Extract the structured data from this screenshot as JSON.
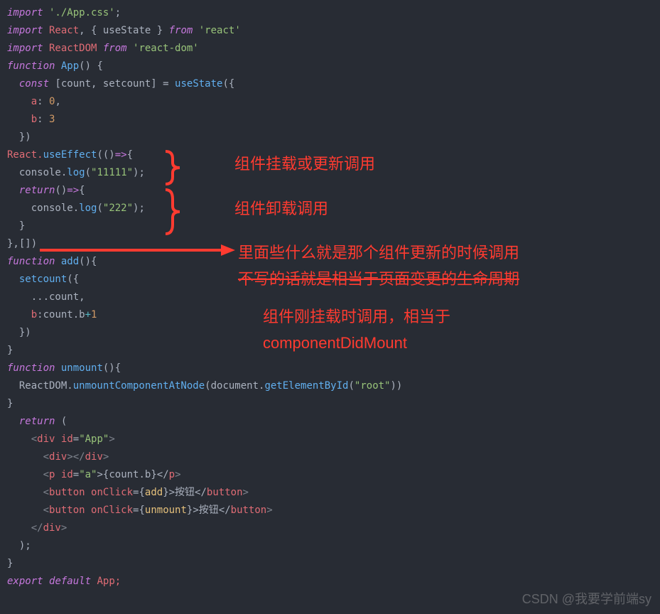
{
  "code": {
    "l1a": "import",
    "l1b": " './App.css'",
    "l1c": ";",
    "l2a": "import",
    "l2b": " React",
    "l2c": ", { useState } ",
    "l2d": "from",
    "l2e": " 'react'",
    "l3a": "import",
    "l3b": " ReactDOM ",
    "l3c": "from",
    "l3d": " 'react-dom'",
    "l4a": "function",
    "l4b": " App",
    "l4c": "() {",
    "l5a": "  ",
    "l5b": "const",
    "l5c": " [count, setcount] = ",
    "l5d": "useState",
    "l5e": "({",
    "l6a": "    ",
    "l6b": "a",
    "l6c": ": ",
    "l6d": "0",
    "l6e": ",",
    "l7a": "    ",
    "l7b": "b",
    "l7c": ": ",
    "l7d": "3",
    "l8": "  })",
    "l9a": "React.",
    "l9b": "useEffect",
    "l9c": "(()",
    "l9d": "=>",
    "l9e": "{",
    "l10a": "  console.",
    "l10b": "log",
    "l10c": "(",
    "l10d": "\"11111\"",
    "l10e": ");",
    "l11a": "  ",
    "l11b": "return",
    "l11c": "()",
    "l11d": "=>",
    "l11e": "{",
    "l12a": "    console.",
    "l12b": "log",
    "l12c": "(",
    "l12d": "\"222\"",
    "l12e": ");",
    "l13": "  }",
    "l14": "},[])",
    "l15a": "function",
    "l15b": " add",
    "l15c": "(){",
    "l16a": "  ",
    "l16b": "setcount",
    "l16c": "({",
    "l17": "    ...count,",
    "l18a": "    ",
    "l18b": "b",
    "l18c": ":count.b",
    "l18d": "+",
    "l18e": "1",
    "l19": "  })",
    "l20": "}",
    "l21a": "function",
    "l21b": " unmount",
    "l21c": "(){",
    "l22a": "  ReactDOM.",
    "l22b": "unmountComponentAtNode",
    "l22c": "(document.",
    "l22d": "getElementById",
    "l22e": "(",
    "l22f": "\"root\"",
    "l22g": "))",
    "l23": "}",
    "l24a": "  ",
    "l24b": "return",
    "l24c": " (",
    "l25a": "    <",
    "l25b": "div",
    "l25c": " ",
    "l25d": "id",
    "l25e": "=",
    "l25f": "\"App\"",
    "l25g": ">",
    "l26a": "      <",
    "l26b": "div",
    "l26c": "></",
    "l26d": "div",
    "l26e": ">",
    "l27a": "      <",
    "l27b": "p",
    "l27c": " ",
    "l27d": "id",
    "l27e": "=",
    "l27f": "\"a\"",
    "l27g": ">{count.b}</",
    "l27h": "p",
    "l27i": ">",
    "l28a": "      <",
    "l28b": "button",
    "l28c": " ",
    "l28d": "onClick",
    "l28e": "={",
    "l28f": "add",
    "l28g": "}>按钮</",
    "l28h": "button",
    "l28i": ">",
    "l29a": "      <",
    "l29b": "button",
    "l29c": " ",
    "l29d": "onClick",
    "l29e": "={",
    "l29f": "unmount",
    "l29g": "}>按钮</",
    "l29h": "button",
    "l29i": ">",
    "l30a": "    </",
    "l30b": "div",
    "l30c": ">",
    "l31": "  );",
    "l32": "}",
    "l33a": "export",
    "l33b": " ",
    "l33c": "default",
    "l33d": " App;"
  },
  "annotations": {
    "a1": "组件挂载或更新调用",
    "a2": "组件卸载调用",
    "a3": "里面些什么就是那个组件更新的时候调用",
    "a4": "不写的话就是相当于页面变更的生命周期",
    "a5": "组件刚挂载时调用，相当于",
    "a6": "componentDidMount"
  },
  "watermark": "CSDN @我要学前端sy"
}
